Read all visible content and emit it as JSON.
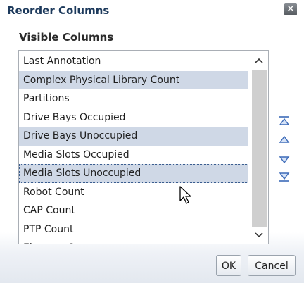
{
  "dialog": {
    "title": "Reorder Columns",
    "close_label": "✕"
  },
  "section": {
    "label": "Visible Columns"
  },
  "list": {
    "items": [
      {
        "label": "Last Annotation",
        "selected": false,
        "focused": false
      },
      {
        "label": "Complex Physical Library Count",
        "selected": true,
        "focused": false
      },
      {
        "label": "Partitions",
        "selected": false,
        "focused": false
      },
      {
        "label": "Drive Bays Occupied",
        "selected": false,
        "focused": false
      },
      {
        "label": "Drive Bays Unoccupied",
        "selected": true,
        "focused": false
      },
      {
        "label": "Media Slots Occupied",
        "selected": false,
        "focused": false
      },
      {
        "label": "Media Slots Unoccupied",
        "selected": true,
        "focused": true
      },
      {
        "label": "Robot Count",
        "selected": false,
        "focused": false
      },
      {
        "label": "CAP Count",
        "selected": false,
        "focused": false
      },
      {
        "label": "PTP Count",
        "selected": false,
        "focused": false
      },
      {
        "label": "Elevator Count",
        "selected": false,
        "focused": false
      }
    ],
    "scroll_up_glyph": "⌃",
    "scroll_down_glyph": "⌄"
  },
  "buttons": {
    "ok_label": "OK",
    "cancel_label": "Cancel"
  },
  "colors": {
    "move_icon": "#3c6ab8",
    "selected_row": "#cfd8e6"
  }
}
